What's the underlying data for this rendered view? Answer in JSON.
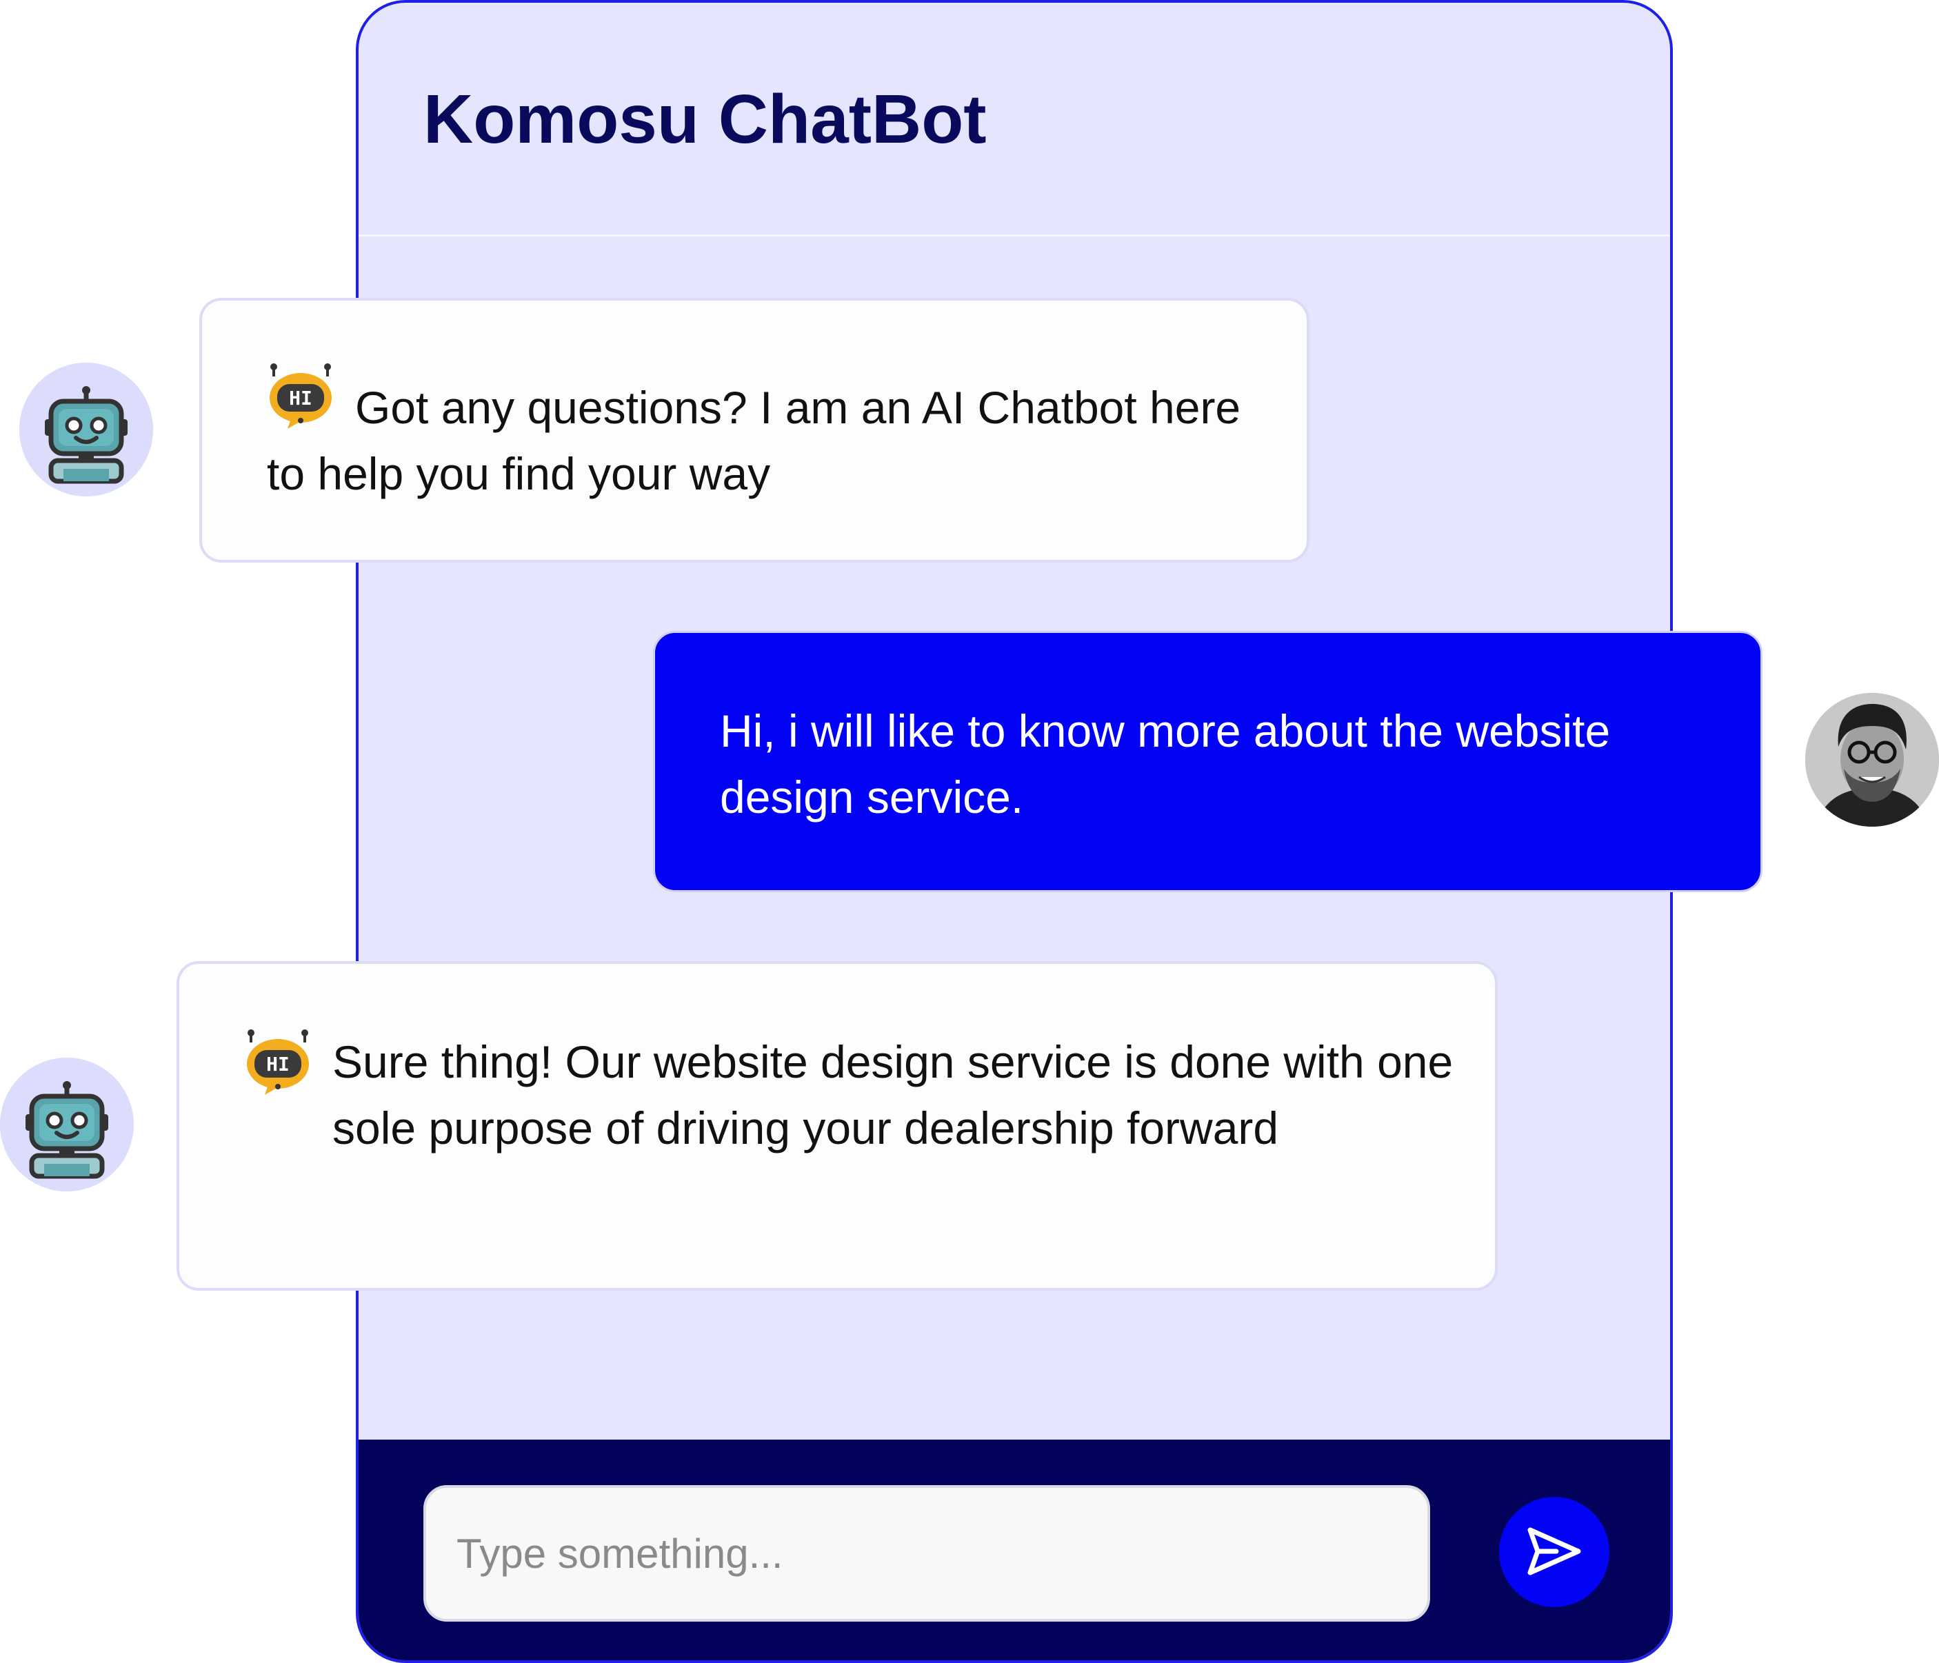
{
  "app": {
    "title": "Komosu ChatBot"
  },
  "messages": [
    {
      "sender": "bot",
      "text": "Got any questions? I am an AI Chatbot here to help you find your way"
    },
    {
      "sender": "user",
      "text": "Hi, i will like to know more about the website design service."
    },
    {
      "sender": "bot",
      "text": "Sure thing! Our website design service is done with one sole purpose of driving your dealership forward"
    }
  ],
  "composer": {
    "placeholder": "Type something..."
  },
  "icons": {
    "bot_avatar": "robot-icon",
    "greeting": "hi-bubble-icon",
    "send": "send-icon"
  },
  "colors": {
    "accent": "#0202f5",
    "panel_background": "#e5e5fe",
    "header_text": "#0a0a5c",
    "composer_background": "#02025a",
    "border": "#1f1fe6"
  }
}
